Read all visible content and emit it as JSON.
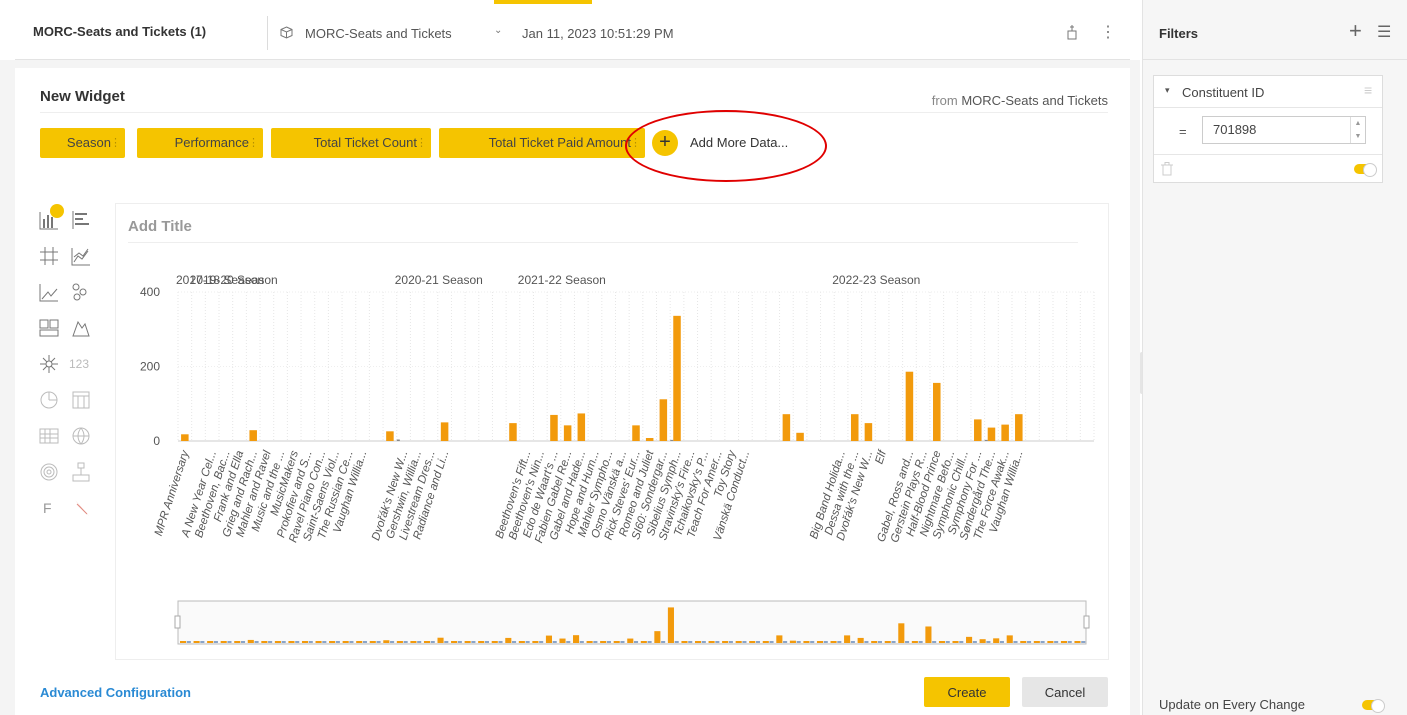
{
  "header": {
    "title": "MORC-Seats and Tickets (1)",
    "datasource": "MORC-Seats and Tickets",
    "timestamp": "Jan 11, 2023 10:51:29 PM"
  },
  "widget": {
    "name": "New Widget",
    "from_label": "from",
    "from_source": "MORC-Seats and Tickets",
    "pills": [
      "Season",
      "Performance",
      "Total Ticket Count",
      "Total Ticket Paid Amount"
    ],
    "add_more": "Add More Data...",
    "add_title_placeholder": "Add Title",
    "advanced_config": "Advanced Configuration",
    "create_label": "Create",
    "cancel_label": "Cancel",
    "chart_type_icons": [
      "column-chart-icon",
      "bar-chart-icon",
      "pivot-grid-icon",
      "area-chart-icon",
      "line-chart-icon",
      "scatter-chart-icon",
      "treemap-icon",
      "map-icon",
      "sunburst-icon",
      "indicator-icon",
      "pie-chart-icon",
      "table-icon",
      "calendar-heatmap-icon",
      "scattermap-icon",
      "polar-chart-icon",
      "tree-chart-icon",
      "function-icon",
      "funnel-icon"
    ],
    "indicator_text": "123",
    "function_text": "F"
  },
  "filters": {
    "title": "Filters",
    "field_name": "Constituent ID",
    "operator": "=",
    "value": "701898",
    "update_label": "Update on Every Change"
  },
  "chart_data": {
    "type": "bar",
    "ylim": [
      0,
      400
    ],
    "yticks": [
      0,
      200,
      400
    ],
    "seasons": [
      {
        "name": "2017-18 Season",
        "start": 0,
        "end": 1
      },
      {
        "name": "2019-20 Season",
        "start": 1,
        "end": 16
      },
      {
        "name": "2020-21 Season",
        "start": 16,
        "end": 25
      },
      {
        "name": "2021-22 Season",
        "start": 25,
        "end": 48
      },
      {
        "name": "2022-23 Season",
        "start": 48,
        "end": 67
      }
    ],
    "categories": [
      "MPR Anniversary",
      "",
      "A New Year Cel...",
      "Beethoven, Bac...",
      "Frank and Ella",
      "Grieg and Rach...",
      "Mahler and Ravel",
      "Music and the ...",
      "MusicMakers",
      "Prokofiev and S...",
      "Ravel Piano Con...",
      "Saint-Saens Viol...",
      "The Russian Ce...",
      "Vaughan Willia...",
      "",
      "",
      "Dvořák's New W...",
      "Gershwin, Willia...",
      "Livestream Dres...",
      "Radiance and Li...",
      "",
      "",
      "",
      "",
      "",
      "Beethoven's Fift...",
      "Beethoven's Nin...",
      "Edo de Waart's ...",
      "Fabien Gabel Re...",
      "Gabel and Hade...",
      "Hope and Hum...",
      "Mahler Sympho...",
      "Osmo Vänskä a...",
      "Rick Steves' Eur...",
      "Romeo and Juliet",
      "SI60: Sondergar...",
      "Sibelius Symph...",
      "Stravinsky's Fire...",
      "Tchaikovsky's P...",
      "Teach For Amer...",
      "Toy Story",
      "Vänskä Conduct...",
      "",
      "",
      "",
      "",
      "",
      "",
      "Big Band Holida...",
      "Dessa with the ...",
      "Dvořák's New W...",
      "Elf",
      "",
      "Gabel, Ross and...",
      "Gerstein Plays R...",
      "Half-Blood Prince",
      "Nightmare Befo...",
      "Symphonic Chill...",
      "Symphony For ...",
      "Søndergård The...",
      "The Force Awak...",
      "Vaughan Willia...",
      "",
      "",
      "",
      "",
      ""
    ],
    "series": [
      {
        "name": "Total Ticket Count",
        "color": "#f29a0c",
        "values": [
          18,
          0,
          0,
          0,
          0,
          29,
          0,
          0,
          0,
          0,
          0,
          0,
          0,
          0,
          0,
          26,
          0,
          0,
          0,
          50,
          0,
          0,
          0,
          0,
          48,
          0,
          0,
          70,
          42,
          74,
          0,
          0,
          0,
          42,
          8,
          112,
          336,
          0,
          0,
          0,
          0,
          0,
          0,
          0,
          72,
          22,
          0,
          0,
          0,
          72,
          48,
          0,
          0,
          186,
          0,
          156,
          0,
          0,
          58,
          36,
          44,
          72,
          0,
          0,
          0,
          0,
          0
        ],
        "overlay": [
          0,
          0,
          0,
          0,
          0,
          0,
          0,
          0,
          0,
          0,
          0,
          0,
          0,
          0,
          0,
          0,
          4,
          0,
          0,
          0,
          0,
          0,
          0,
          0,
          0,
          0,
          0,
          0,
          0,
          0,
          0,
          0,
          0,
          0,
          0,
          0,
          3,
          0,
          0,
          0,
          0,
          0,
          0,
          0,
          0,
          0,
          0,
          0,
          0,
          0,
          0,
          0,
          0,
          0,
          0,
          0,
          0,
          0,
          0,
          3,
          0,
          0,
          0,
          0,
          0,
          0,
          0
        ]
      }
    ]
  }
}
